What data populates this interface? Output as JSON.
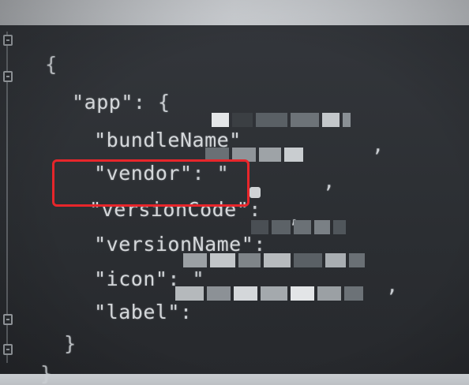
{
  "editor": {
    "lines": {
      "open_brace": "{",
      "app_key": "\"app\"",
      "app_colon": ": {",
      "bundle_name_key": "\"bundleName\"",
      "vendor_key": "\"vendor\"",
      "vendor_colon": ": \"",
      "version_code_key": "\"versionCode\"",
      "version_code_colon": ":",
      "version_name_key": "\"versionName\"",
      "version_name_colon": ":",
      "icon_key": "\"icon\"",
      "icon_colon": ": \"",
      "label_key": "\"label\"",
      "label_colon": ":",
      "inner_close": "}",
      "outer_close": "}",
      "comma": ","
    },
    "highlight_color": "#e8262b",
    "redacted_note": "values obscured"
  }
}
